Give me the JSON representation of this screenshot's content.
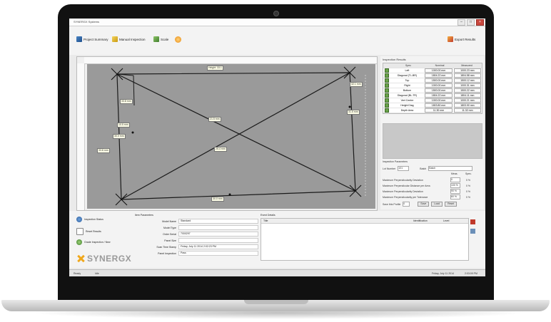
{
  "window": {
    "title": "SYNERGX Systems"
  },
  "toolbar": {
    "items": [
      {
        "label": "Project Summary"
      },
      {
        "label": "Manual Inspection"
      },
      {
        "label": "Scale"
      },
      {
        "label": ""
      },
      {
        "label": "Export Results"
      }
    ]
  },
  "canvas": {
    "labels": [
      "Height: 33.1",
      "32.1 mm",
      "33.8 mm",
      "31.5 mm",
      "10.5 mm",
      "21.5 mm",
      "30.0 mm",
      "33.8 mm",
      "25.4 mm",
      "30.0 mm"
    ]
  },
  "results": {
    "title": "Inspection Results",
    "headers": [
      "Spec",
      "Nominal",
      "Measured"
    ],
    "rows": [
      {
        "spec": "Left",
        "nominal": "1000.00 mm",
        "measured": "1000.23 mm"
      },
      {
        "spec": "Diagonal (TL-BR)",
        "nominal": "1804.22 mm",
        "measured": "1804.58 mm"
      },
      {
        "spec": "Top",
        "nominal": "1500.00 mm",
        "measured": "1500.12 mm"
      },
      {
        "spec": "Right",
        "nominal": "1000.00 mm",
        "measured": "1000.31 mm"
      },
      {
        "spec": "Bottom",
        "nominal": "1500.00 mm",
        "measured": "1500.22 mm"
      },
      {
        "spec": "Diagonal (BL-TR)",
        "nominal": "1804.22 mm",
        "measured": "1804.11 mm"
      },
      {
        "spec": "Vert Centre",
        "nominal": "1000.00 mm",
        "measured": "1000.21 mm"
      },
      {
        "spec": "Height Diag",
        "nominal": "1803.80 mm",
        "measured": "1803.90 mm"
      },
      {
        "spec": "Depth Area",
        "nominal": "11.30 mm",
        "measured": "11.32 mm"
      }
    ]
  },
  "parameters": {
    "title": "Inspection Parameters",
    "lot_label": "Lot Number",
    "lot_value": "101",
    "batch_label": "Batch",
    "batch_value": "Batch",
    "col_a": "Meas.",
    "col_b": "Spec.",
    "rows": [
      {
        "label": "Maximum Perpendicularity Deviation",
        "a": "0",
        "b": "0 %"
      },
      {
        "label": "Maximum Perpendicular Distance per Area",
        "a": "100 %",
        "b": "0 %"
      },
      {
        "label": "Maximum Perpendicularity Deviation",
        "a": "90 %",
        "b": "0 %"
      },
      {
        "label": "Maximum Perpendicularity per Tolerance",
        "a": "60 %",
        "b": "0 %"
      }
    ],
    "save_label": "Save this Profile",
    "save_value": "0",
    "buttons": [
      "Save",
      "Load",
      "Reset"
    ]
  },
  "left_panel": {
    "options": [
      {
        "label": "Inspection Status"
      },
      {
        "label": "Reset Results"
      },
      {
        "label": "Grade Inspection / New"
      }
    ],
    "logo_text": "SYNERGX"
  },
  "info": {
    "title": "Item Parameters",
    "fields": [
      {
        "label": "Model Name",
        "value": "Standard"
      },
      {
        "label": "Model Type",
        "value": ""
      },
      {
        "label": "Order Serial",
        "value": "7000297"
      },
      {
        "label": "Panel Size",
        "value": ""
      },
      {
        "label": "Scan Time Stamp",
        "value": "Friday, July 11 2014 2:02:23 PM"
      },
      {
        "label": "Panel Inspection",
        "value": "Pass"
      }
    ]
  },
  "events": {
    "title": "Event Details",
    "col1": "Title",
    "col2": "Identification",
    "col3": "Level"
  },
  "status": {
    "left": "Ready",
    "mid": "Idle",
    "date": "Friday, July 11 2014",
    "time": "2:03:09 PM"
  }
}
